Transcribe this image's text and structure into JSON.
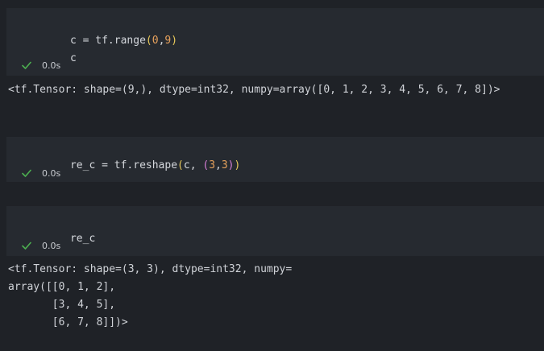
{
  "cells": [
    {
      "code": [
        {
          "var": "c",
          "op": " = ",
          "call": "tf.range",
          "paren_open": "(",
          "arg1": "0",
          "comma": ",",
          "arg2": "9",
          "paren_close": ")"
        },
        {
          "text": "c"
        }
      ],
      "status": {
        "icon": "check-icon",
        "time": "0.0s"
      },
      "output": [
        "<tf.Tensor: shape=(9,), dtype=int32, numpy=array([0, 1, 2, 3, 4, 5, 6, 7, 8])>"
      ]
    },
    {
      "code": [
        {
          "var": "re_c",
          "op": " = ",
          "call": "tf.reshape",
          "paren_open": "(",
          "arg_var": "c, ",
          "inner_open": "(",
          "arg1": "3",
          "comma": ",",
          "arg2": "3",
          "inner_close": ")",
          "paren_close": ")"
        }
      ],
      "status": {
        "icon": "check-icon",
        "time": "0.0s"
      },
      "output": []
    },
    {
      "code": [
        {
          "text": "re_c"
        }
      ],
      "status": {
        "icon": "check-icon",
        "time": "0.0s"
      },
      "output": [
        "<tf.Tensor: shape=(3, 3), dtype=int32, numpy=",
        "array([[0, 1, 2],",
        "       [3, 4, 5],",
        "       [6, 7, 8]])>"
      ]
    }
  ],
  "colors": {
    "background": "#1f2227",
    "cell_background": "#262a30",
    "check": "#4caf50",
    "number": "#e6a15c",
    "paren_outer": "#e8c95a",
    "paren_inner": "#d77fd6"
  }
}
